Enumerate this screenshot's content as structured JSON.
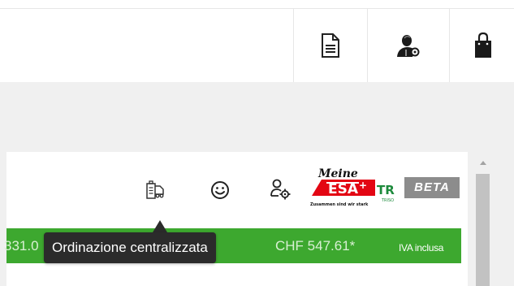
{
  "header": {
    "document_icon": "document-icon",
    "account_icon": "user-settings-icon",
    "cart_icon": "shopping-bag-icon"
  },
  "toolbar": {
    "central_order_icon": "central-order-icon",
    "smiley_icon": "smiley-icon",
    "user_settings_icon": "user-gear-icon",
    "logo": {
      "line1": "Meine",
      "brand": "ESA",
      "plus": "+",
      "tagline": "Zusammen sind wir stark",
      "partner": "TR",
      "partner_sub": "TRISO"
    },
    "beta_label": "BETA"
  },
  "price_bar": {
    "left_price": "331.0",
    "right_price": "CHF 547.61*",
    "vat_label": "IVA inclusa",
    "color": "#3da82f"
  },
  "tooltip": {
    "text": "Ordinazione centralizzata"
  }
}
